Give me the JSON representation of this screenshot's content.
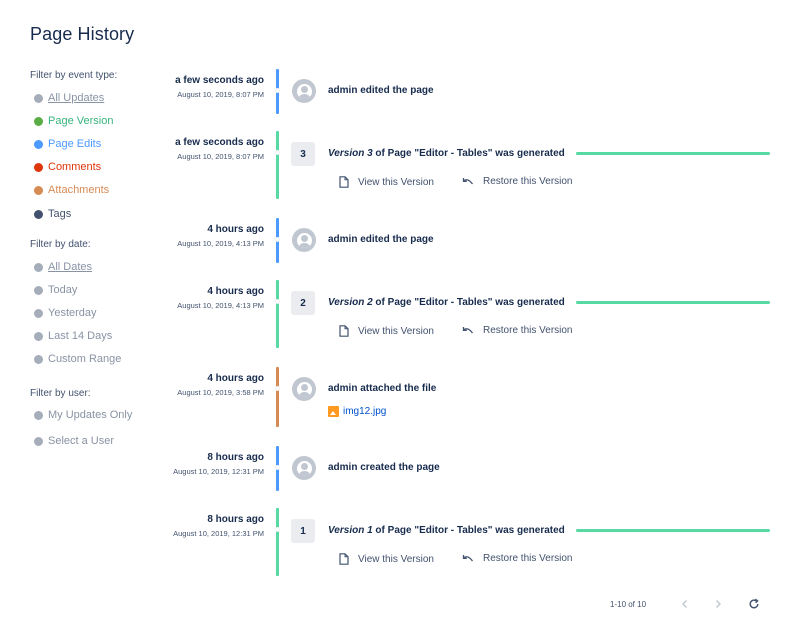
{
  "page": {
    "title": "Page History"
  },
  "filters": {
    "event_heading": "Filter by event type:",
    "event_types": [
      {
        "label": "All Updates",
        "color": "#a5adba",
        "underline": true
      },
      {
        "label": "Page Version",
        "color": "#5aac44",
        "text_color": "#36b37e"
      },
      {
        "label": "Page Edits",
        "color": "#4c9aff",
        "text_color": "#4c9aff"
      },
      {
        "label": "Comments",
        "color": "#de350b",
        "text_color": "#de350b"
      },
      {
        "label": "Attachments",
        "color": "#d68b55",
        "text_color": "#d68b55"
      },
      {
        "label": "Tags",
        "color": "#42526e",
        "text_color": "#42526e"
      }
    ],
    "date_heading": "Filter by date:",
    "dates": [
      {
        "label": "All Dates",
        "underline": true
      },
      {
        "label": "Today"
      },
      {
        "label": "Yesterday"
      },
      {
        "label": "Last 14 Days"
      },
      {
        "label": "Custom Range"
      }
    ],
    "user_heading": "Filter by user:",
    "users": [
      {
        "label": "My Updates Only"
      },
      {
        "label": "Select a User"
      }
    ]
  },
  "events": [
    {
      "kind": "edit",
      "time_ago": "a few seconds ago",
      "date": "August 10, 2019, 8:07 PM",
      "text": "admin edited the page",
      "bar_color": "#4c9aff"
    },
    {
      "kind": "version",
      "time_ago": "a few seconds ago",
      "date": "August 10, 2019, 8:07 PM",
      "number": "3",
      "version_label": "Version 3",
      "version_suffix": " of Page \"Editor - Tables\" was generated",
      "view_label": "View this Version",
      "restore_label": "Restore this Version",
      "bar_color": "#57d9a3"
    },
    {
      "kind": "edit",
      "time_ago": "4 hours ago",
      "date": "August 10, 2019, 4:13 PM",
      "text": "admin edited the page",
      "bar_color": "#4c9aff"
    },
    {
      "kind": "version",
      "time_ago": "4 hours ago",
      "date": "August 10, 2019, 4:13 PM",
      "number": "2",
      "version_label": "Version 2",
      "version_suffix": " of Page \"Editor - Tables\" was generated",
      "view_label": "View this Version",
      "restore_label": "Restore this Version",
      "bar_color": "#57d9a3"
    },
    {
      "kind": "attachment",
      "time_ago": "4 hours ago",
      "date": "August 10, 2019, 3:58 PM",
      "text": "admin attached the file",
      "file": "img12.jpg",
      "bar_color": "#d68b55"
    },
    {
      "kind": "edit",
      "time_ago": "8 hours ago",
      "date": "August 10, 2019, 12:31 PM",
      "text": "admin created the page",
      "bar_color": "#4c9aff"
    },
    {
      "kind": "version",
      "time_ago": "8 hours ago",
      "date": "August 10, 2019, 12:31 PM",
      "number": "1",
      "version_label": "Version 1",
      "version_suffix": " of Page \"Editor - Tables\" was generated",
      "view_label": "View this Version",
      "restore_label": "Restore this Version",
      "bar_color": "#57d9a3"
    }
  ],
  "pagination": {
    "range": "1-10 of 10"
  }
}
